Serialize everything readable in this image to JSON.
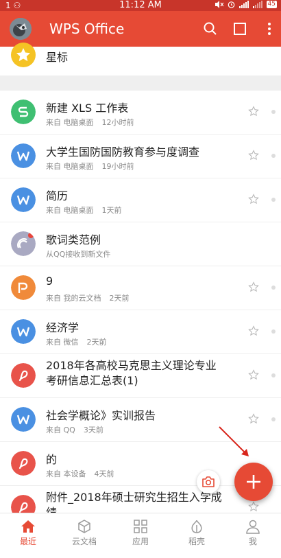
{
  "status_bar": {
    "time": "11:12 AM",
    "left_icons": "1 ⚇",
    "battery": "45"
  },
  "app_bar": {
    "title": "WPS Office",
    "icons": [
      "search-icon",
      "select-icon",
      "more-vert-icon"
    ]
  },
  "starred": {
    "label": "星标",
    "icon": "star-icon"
  },
  "files": [
    {
      "name": "新建 XLS 工作表",
      "source": "来自 电脑桌面",
      "time": "12小时前",
      "type": "S",
      "color": "#3fbf72"
    },
    {
      "name": "大学生国防国防教育参与度调查",
      "source": "来自 电脑桌面",
      "time": "19小时前",
      "type": "W",
      "color": "#4a90e2"
    },
    {
      "name": "简历",
      "source": "来自 电脑桌面",
      "time": "1天前",
      "type": "W",
      "color": "#4a90e2"
    },
    {
      "name": "歌词类范例",
      "source": "从QQ接收到新文件",
      "time": "",
      "type": "qq",
      "color": "#a9a9c2"
    },
    {
      "name": "9",
      "source": "来自 我的云文档",
      "time": "2天前",
      "type": "P",
      "color": "#f08a3a"
    },
    {
      "name": "经济学",
      "source": "来自 微信",
      "time": "2天前",
      "type": "W",
      "color": "#4a90e2"
    },
    {
      "name": "2018年各高校马克思主义理论专业",
      "name2": "考研信息汇总表(1)",
      "source": "",
      "time": "",
      "type": "pdf",
      "color": "#e8534a"
    },
    {
      "name": "社会学概论》实训报告",
      "source": "来自 QQ",
      "time": "3天前",
      "type": "W",
      "color": "#4a90e2"
    },
    {
      "name": "的",
      "source": "来自 本设备",
      "time": "4天前",
      "type": "pdf",
      "color": "#e8534a"
    },
    {
      "name": "附件_2018年硕士研究生招生入学成",
      "name2": "绩",
      "source": "",
      "time": "",
      "type": "pdf",
      "color": "#e8534a"
    }
  ],
  "fab": {
    "icon": "plus-icon"
  },
  "camera": {
    "icon": "camera-icon"
  },
  "bottom_nav": [
    {
      "label": "最近",
      "icon": "home-icon",
      "active": true
    },
    {
      "label": "云文档",
      "icon": "cloud-box-icon",
      "active": false
    },
    {
      "label": "应用",
      "icon": "apps-icon",
      "active": false
    },
    {
      "label": "稻壳",
      "icon": "leaf-icon",
      "active": false
    },
    {
      "label": "我",
      "icon": "person-icon",
      "active": false
    }
  ],
  "colors": {
    "accent": "#e64a35",
    "status_bar": "#c8352a",
    "nav_active": "#e64a35"
  }
}
